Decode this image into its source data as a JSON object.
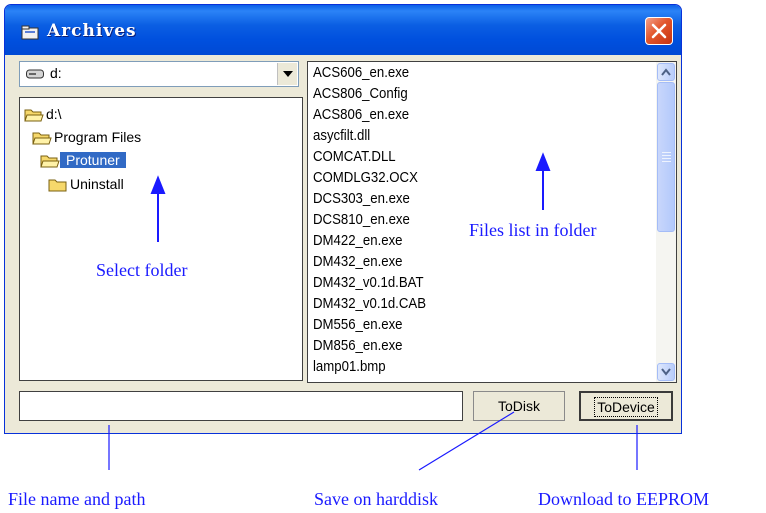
{
  "window": {
    "title": "Archives"
  },
  "drive_selector": {
    "value": "d:"
  },
  "folder_tree": {
    "items": [
      {
        "label": "d:\\"
      },
      {
        "label": "Program Files"
      },
      {
        "label": "Protuner"
      },
      {
        "label": "Uninstall"
      }
    ],
    "selected": "Protuner"
  },
  "file_list": {
    "items": [
      "ACS606_en.exe",
      "ACS806_Config",
      "ACS806_en.exe",
      "asycfilt.dll",
      "COMCAT.DLL",
      "COMDLG32.OCX",
      "DCS303_en.exe",
      "DCS810_en.exe",
      "DM422_en.exe",
      "DM432_en.exe",
      "DM432_v0.1d.BAT",
      "DM432_v0.1d.CAB",
      "DM556_en.exe",
      "DM856_en.exe",
      "lamp01.bmp"
    ]
  },
  "filename_input": {
    "value": ""
  },
  "buttons": {
    "to_disk": "ToDisk",
    "to_device": "ToDevice"
  },
  "annotations": {
    "select_folder": "Select folder",
    "files_list": "Files list in folder",
    "file_name_path": "File name and path",
    "save_harddisk": "Save on harddisk",
    "download_eeprom": "Download to EEPROM"
  },
  "colors": {
    "title_bar": "#0054e3",
    "selection": "#316ac5",
    "annotation": "#1a1aff",
    "close_button": "#e2562c"
  }
}
